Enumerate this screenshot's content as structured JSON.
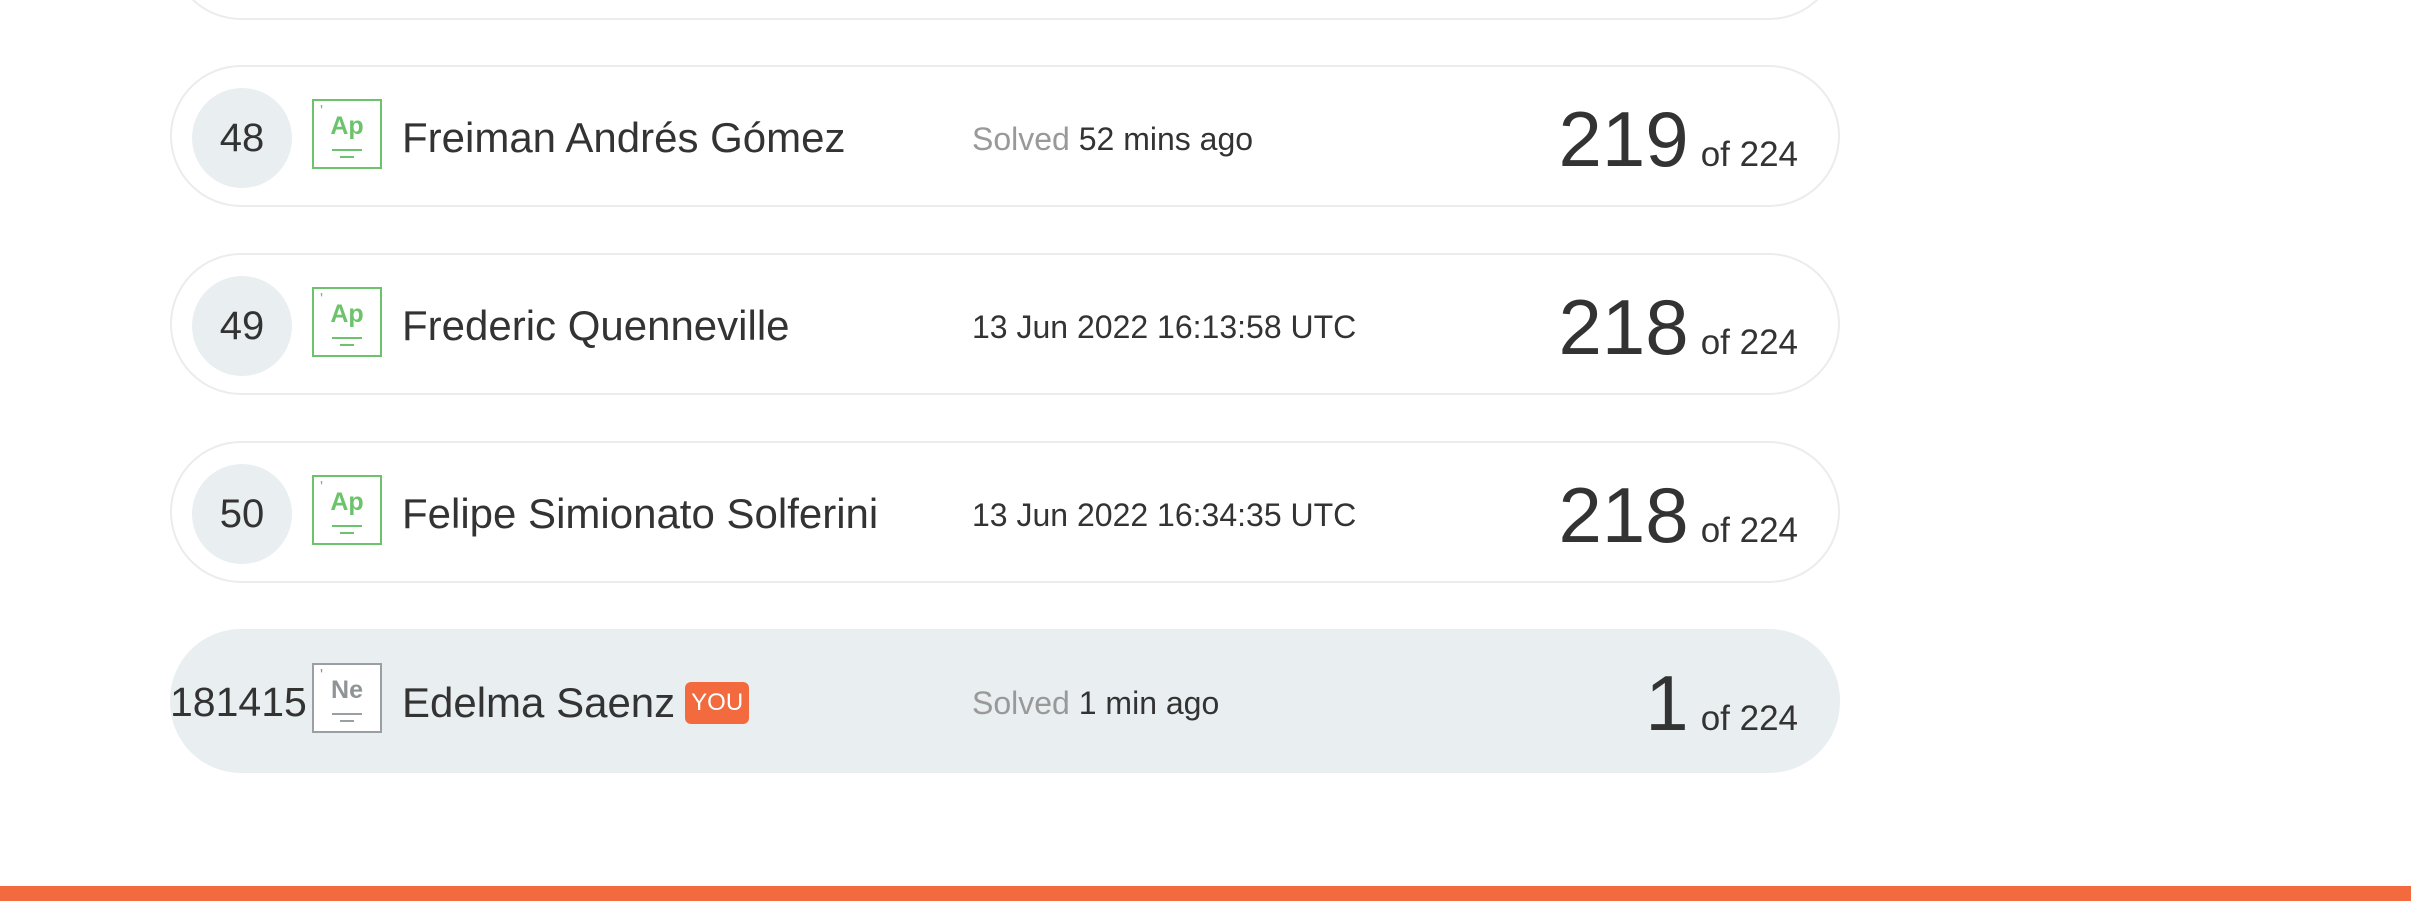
{
  "leaderboard": {
    "rows": [
      {
        "rank": "48",
        "badge": {
          "symbol": "Ap",
          "color": "#6cc36c",
          "icon": "element-badge-icon"
        },
        "name": "Freiman Andrés Gómez",
        "solved_prefix": "Solved",
        "solved_time": "52 mins ago",
        "score": "219",
        "of_total": "of 224"
      },
      {
        "rank": "49",
        "badge": {
          "symbol": "Ap",
          "color": "#6cc36c",
          "icon": "element-badge-icon"
        },
        "name": "Frederic Quenneville",
        "solved_prefix": "",
        "solved_time": "13 Jun 2022 16:13:58 UTC",
        "score": "218",
        "of_total": "of 224"
      },
      {
        "rank": "50",
        "badge": {
          "symbol": "Ap",
          "color": "#6cc36c",
          "icon": "element-badge-icon"
        },
        "name": "Felipe Simionato Solferini",
        "solved_prefix": "",
        "solved_time": "13 Jun 2022 16:34:35 UTC",
        "score": "218",
        "of_total": "of 224"
      }
    ],
    "current_user": {
      "rank": "181415",
      "badge": {
        "symbol": "Ne",
        "color": "#9a9fa3",
        "icon": "element-badge-icon"
      },
      "name": "Edelma Saenz",
      "you_label": "YOU",
      "solved_prefix": "Solved",
      "solved_time": "1 min ago",
      "score": "1",
      "of_total": "of 224"
    }
  },
  "colors": {
    "accent": "#f26a3d",
    "badge_green": "#6cc36c",
    "row_highlight": "#e9eef1"
  }
}
